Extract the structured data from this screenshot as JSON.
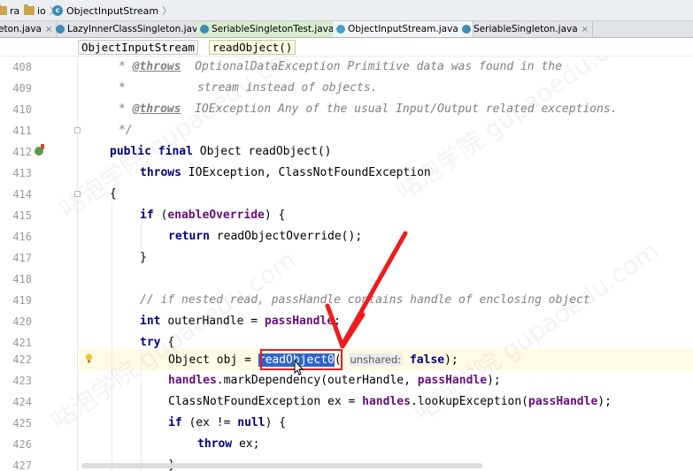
{
  "breadcrumb": {
    "items": [
      {
        "label": "ra",
        "icon": "folder-icon"
      },
      {
        "label": "io",
        "icon": "folder-icon"
      },
      {
        "label": "ObjectInputStream",
        "icon": "class-icon"
      }
    ]
  },
  "tabs": [
    {
      "label": "eton.java",
      "state": "normal"
    },
    {
      "label": "LazyInnerClassSingleton.java",
      "state": "normal"
    },
    {
      "label": "SeriableSingletonTest.java",
      "state": "green"
    },
    {
      "label": "ObjectInputStream.java",
      "state": "active"
    },
    {
      "label": "SeriableSingleton.java",
      "state": "normal"
    }
  ],
  "tab_close_glyph": "×",
  "subheader": {
    "class_chip": "ObjectInputStream",
    "method_chip": "readObject()"
  },
  "colors": {
    "keyword": "#000080",
    "field": "#660e7a",
    "comment": "#808080",
    "selection": "#2f65ca",
    "current_line": "#fffae3",
    "annotation_arrow": "#ee1c1c"
  },
  "editor": {
    "lines": [
      {
        "n": "408"
      },
      {
        "n": "409"
      },
      {
        "n": "410"
      },
      {
        "n": "411"
      },
      {
        "n": "412"
      },
      {
        "n": "413"
      },
      {
        "n": "414"
      },
      {
        "n": "415"
      },
      {
        "n": "416"
      },
      {
        "n": "417"
      },
      {
        "n": "418"
      },
      {
        "n": "419"
      },
      {
        "n": "420"
      },
      {
        "n": "421"
      },
      {
        "n": "422"
      },
      {
        "n": "423"
      },
      {
        "n": "424"
      },
      {
        "n": "425"
      },
      {
        "n": "426"
      },
      {
        "n": "427"
      }
    ],
    "t": {
      "star": "*",
      "throws_tag": "@throws",
      "l408_ex": "OptionalDataException",
      "l408_desc": "Primitive data was found in the",
      "l409_desc": "stream instead of objects.",
      "l410_ex": "IOException",
      "l410_desc": "Any of the usual Input/Output related exceptions.",
      "l411": "*/",
      "public": "public",
      "final": "final",
      "l412_rest": "Object readObject()",
      "throws": "throws",
      "l413_rest": "IOException, ClassNotFoundException",
      "brace_open": "{",
      "if": "if",
      "paren_open": "(",
      "enableOverride": "enableOverride",
      "l415_tail": ") {",
      "return": "return",
      "l416_rest": "readObjectOverride();",
      "brace_close": "}",
      "l419_cmt": "// if nested read, passHandle contains handle of enclosing object",
      "int": "int",
      "l420_mid": "outerHandle =",
      "passHandle": "passHandle",
      "semicolon": ";",
      "try": "try",
      "l421_tail": "{",
      "l422_pre": "Object obj =",
      "readObject0": "readObject0",
      "hint_unshared": "unshared:",
      "false": "false",
      "l422_tail": ");",
      "handles": "handles",
      "l423_mid": ".markDependency(outerHandle,",
      "l423_tail": ");",
      "l424_pre": "ClassNotFoundException ex =",
      "l424_mid": ".lookupException(",
      "l425_mid": "(ex !=",
      "null": "null",
      "l425_tail": ") {",
      "throw": "throw",
      "l426_rest": "ex;",
      "l427": "}"
    }
  },
  "watermark": "咕泡学院 gupaoedu.com"
}
